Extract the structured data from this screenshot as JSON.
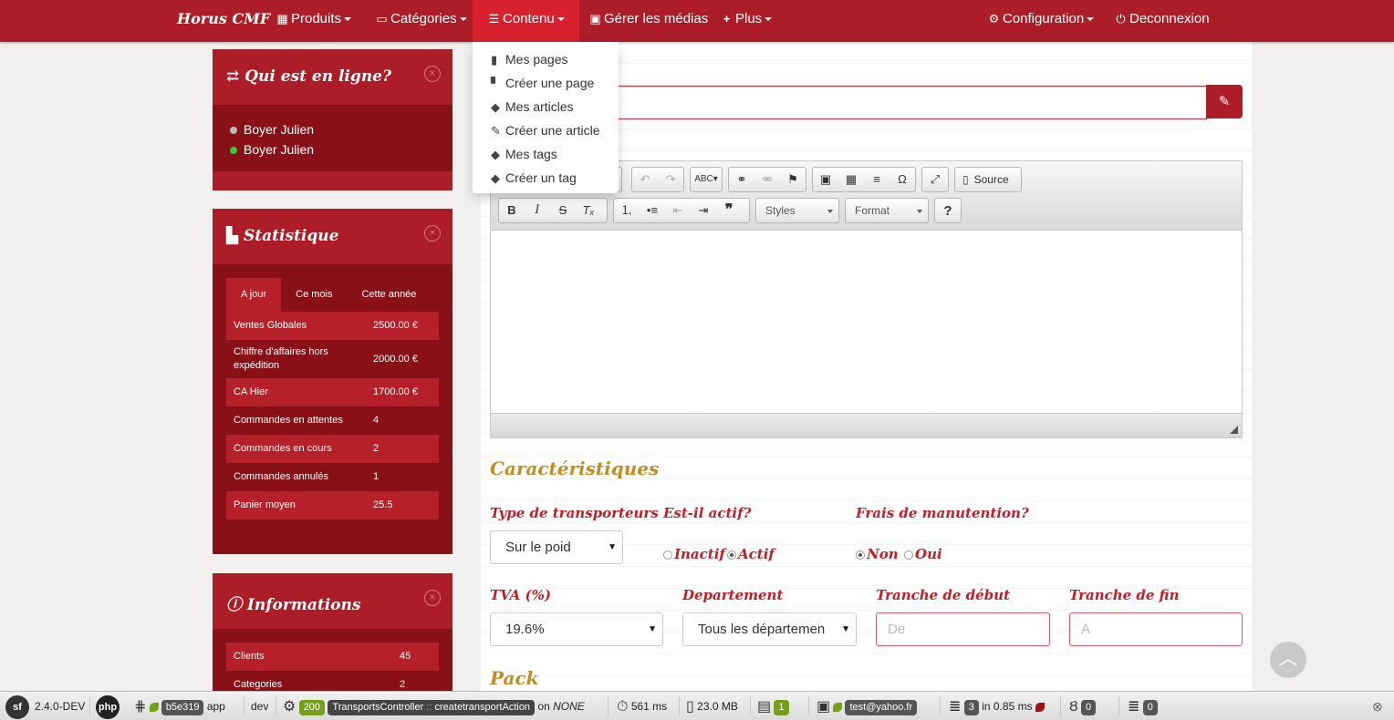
{
  "navbar": {
    "brand": "Horus CMF",
    "items": [
      {
        "label": "Produits",
        "icon": "th-large-icon"
      },
      {
        "label": "Catégories",
        "icon": "folder-open-icon"
      },
      {
        "label": "Contenu",
        "icon": "list-alt-icon"
      },
      {
        "label": "Gérer les médias",
        "icon": "picture-icon"
      },
      {
        "label": "Plus",
        "icon": "plus-icon"
      }
    ],
    "config": "Configuration",
    "logout": "Deconnexion"
  },
  "dropdown": {
    "items": [
      {
        "label": "Mes pages",
        "icon": "book-icon"
      },
      {
        "label": "Créer une page",
        "icon": "file-icon"
      },
      {
        "label": "Mes articles",
        "icon": "tags-icon"
      },
      {
        "label": "Créer une article",
        "icon": "pencil-icon"
      },
      {
        "label": "Mes tags",
        "icon": "tags-icon"
      },
      {
        "label": "Créer un tag",
        "icon": "tag-icon"
      }
    ]
  },
  "online": {
    "title": "Qui est en ligne?",
    "close": "×",
    "users": [
      {
        "name": "Boyer Julien",
        "status_color": "#bbbbbb"
      },
      {
        "name": "Boyer Julien",
        "status_color": "#2ecc40"
      }
    ]
  },
  "stats": {
    "title": "Statistique",
    "close": "×",
    "tabs": [
      "A jour",
      "Ce mois",
      "Cette année"
    ],
    "rows": [
      {
        "label": "Ventes Globales",
        "value": "2500.00 €"
      },
      {
        "label": "Chiffre d'affaires hors expédition",
        "value": "2000.00 €"
      },
      {
        "label": "CA Hier",
        "value": "1700.00 €"
      },
      {
        "label": "Commandes en attentes",
        "value": "4"
      },
      {
        "label": "Commandes en cours",
        "value": "2"
      },
      {
        "label": "Commandes annulés",
        "value": "1"
      },
      {
        "label": "Panier moyen",
        "value": "25.5"
      }
    ]
  },
  "informations": {
    "title": "Informations",
    "close": "×",
    "rows": [
      {
        "label": "Clients",
        "value": "45"
      },
      {
        "label": "Categories",
        "value": "2"
      }
    ]
  },
  "editor": {
    "source_label": "Source",
    "styles_label": "Styles",
    "format_label": "Format",
    "help_label": "?"
  },
  "form": {
    "section_caracteristiques": "Caractéristiques",
    "label_transporteur": "Type de transporteurs",
    "transporteur_value": "Sur le poid",
    "label_actif": "Est-il actif?",
    "radio_inactif": "Inactif",
    "radio_actif": "Actif",
    "label_frais": "Frais de manutention?",
    "radio_non": "Non",
    "radio_oui": "Oui",
    "label_tva": "TVA (%)",
    "tva_value": "19.6%",
    "label_departement": "Departement",
    "departement_value": "Tous les départemen",
    "label_tranche_debut": "Tranche de début",
    "tranche_debut_placeholder": "De",
    "label_tranche_fin": "Tranche de fin",
    "tranche_fin_placeholder": "A",
    "section_pack": "Pack"
  },
  "debugbar": {
    "version": "2.4.0-DEV",
    "token": "b5e319",
    "app": "app",
    "env": "dev",
    "status": "200",
    "controller": "TransportsController",
    "separator": "::",
    "action": "createtransportAction",
    "route_on": "on",
    "route": "NONE",
    "time": "561 ms",
    "memory": "23.0 MB",
    "logs": "1",
    "user": "test@yahoo.fr",
    "queries": "3",
    "queries_time": "in 0.85 ms",
    "twig": "0",
    "cache": "0"
  }
}
